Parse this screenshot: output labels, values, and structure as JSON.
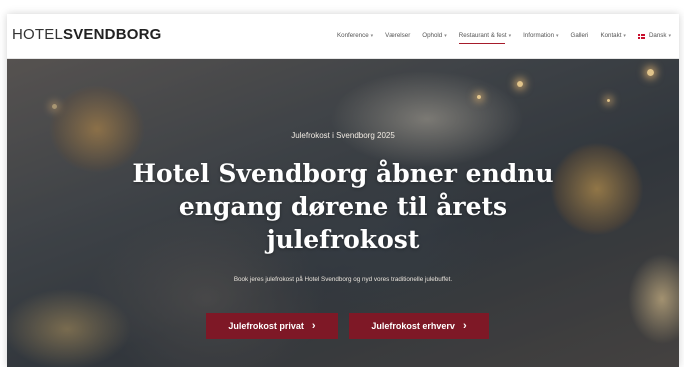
{
  "brand": {
    "logo_light": "HOTEL",
    "logo_bold": "SVENDBORG"
  },
  "nav": {
    "items": [
      {
        "label": "Konference",
        "caret": true,
        "active": false
      },
      {
        "label": "Værelser",
        "caret": false,
        "active": false
      },
      {
        "label": "Ophold",
        "caret": true,
        "active": false
      },
      {
        "label": "Restaurant & fest",
        "caret": true,
        "active": true
      },
      {
        "label": "Information",
        "caret": true,
        "active": false
      },
      {
        "label": "Galleri",
        "caret": false,
        "active": false
      },
      {
        "label": "Kontakt",
        "caret": true,
        "active": false
      }
    ],
    "language": "Dansk"
  },
  "hero": {
    "eyebrow": "Julefrokost i Svendborg 2025",
    "title": "Hotel Svendborg åbner endnu engang dørene til årets julefrokost",
    "subtitle": "Book jeres julefrokost på Hotel Svendborg og nyd vores traditionelle julebuffet.",
    "buttons": [
      {
        "label": "Julefrokost privat"
      },
      {
        "label": "Julefrokost erhverv"
      }
    ]
  },
  "colors": {
    "accent": "#7e1826",
    "nav_underline": "#a61b2b"
  },
  "icons": {
    "button_arrow": "chevron-right-icon",
    "dropdown": "chevron-down-icon",
    "language_flag": "danish-flag-icon"
  }
}
